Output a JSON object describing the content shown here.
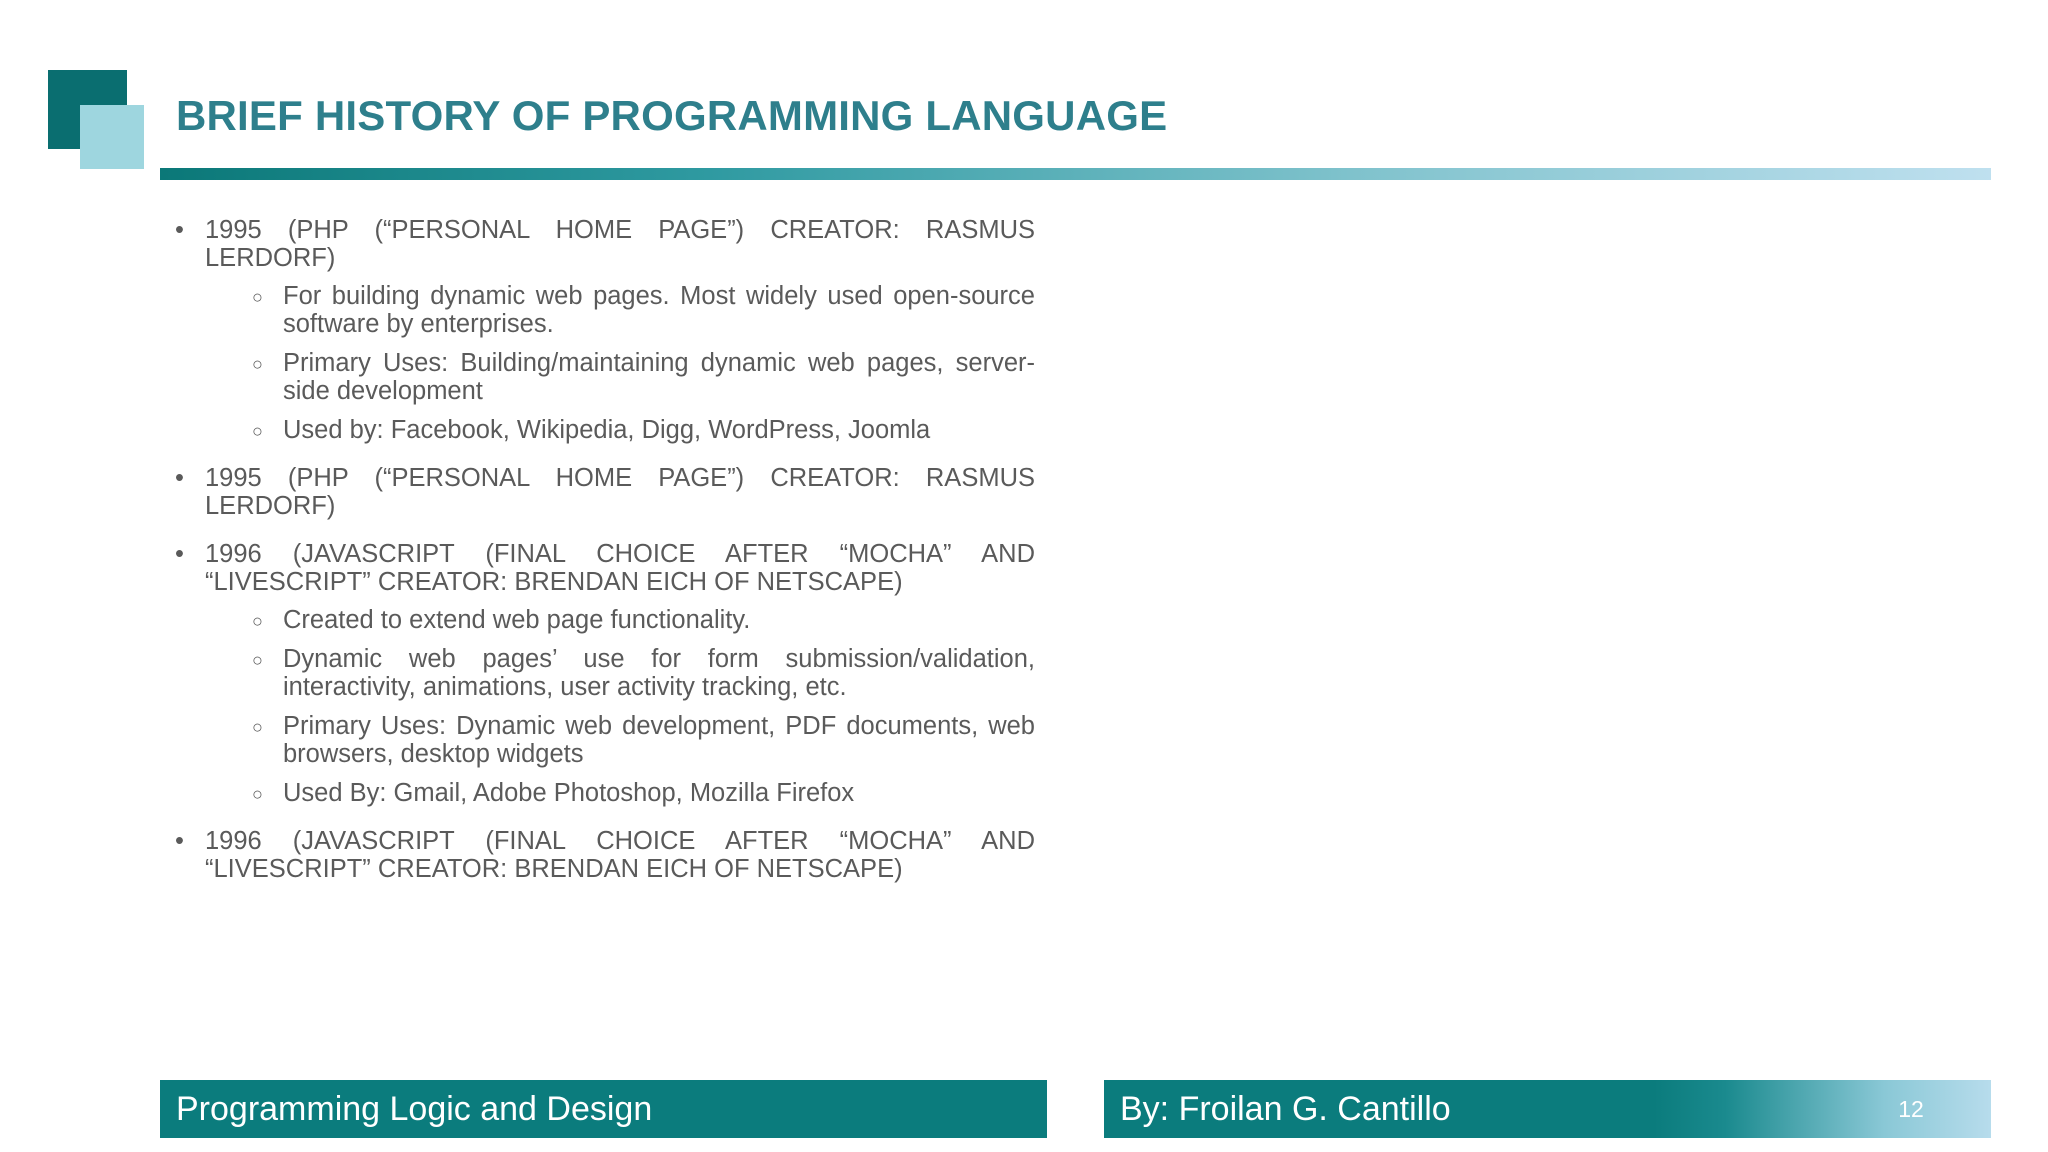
{
  "slide": {
    "title": "BRIEF HISTORY OF PROGRAMMING LANGUAGE",
    "items": [
      {
        "text": "1995 (PHP (“PERSONAL HOME PAGE”) CREATOR: RASMUS LERDORF)",
        "subitems": [
          "For building dynamic web pages. Most widely used open-source software by enterprises.",
          "Primary Uses: Building/maintaining dynamic web pages, server-side development",
          "Used by: Facebook, Wikipedia, Digg, WordPress, Joomla"
        ]
      },
      {
        "text": "1995 (PHP (“PERSONAL HOME PAGE”) CREATOR: RASMUS LERDORF)"
      },
      {
        "text": "1996 (JAVASCRIPT (FINAL CHOICE AFTER “MOCHA” AND “LIVESCRIPT” CREATOR: BRENDAN EICH OF NETSCAPE)",
        "subitems": [
          "Created to extend web page functionality.",
          "Dynamic web pages’ use for form submission/validation, interactivity, animations, user activity tracking, etc.",
          "Primary Uses: Dynamic web development, PDF documents, web browsers, desktop widgets",
          "Used By: Gmail, Adobe Photoshop, Mozilla Firefox"
        ]
      },
      {
        "text": "1996 (JAVASCRIPT (FINAL CHOICE AFTER “MOCHA” AND “LIVESCRIPT” CREATOR: BRENDAN EICH OF NETSCAPE)"
      }
    ]
  },
  "footer": {
    "course": "Programming Logic and Design",
    "author": "By: Froilan G. Cantillo",
    "page_number": "12"
  },
  "colors": {
    "title": "#2e7f8c",
    "accent_dark": "#0b7c7d",
    "accent_light": "#9ed6df",
    "body_text": "#5a5a5a"
  }
}
